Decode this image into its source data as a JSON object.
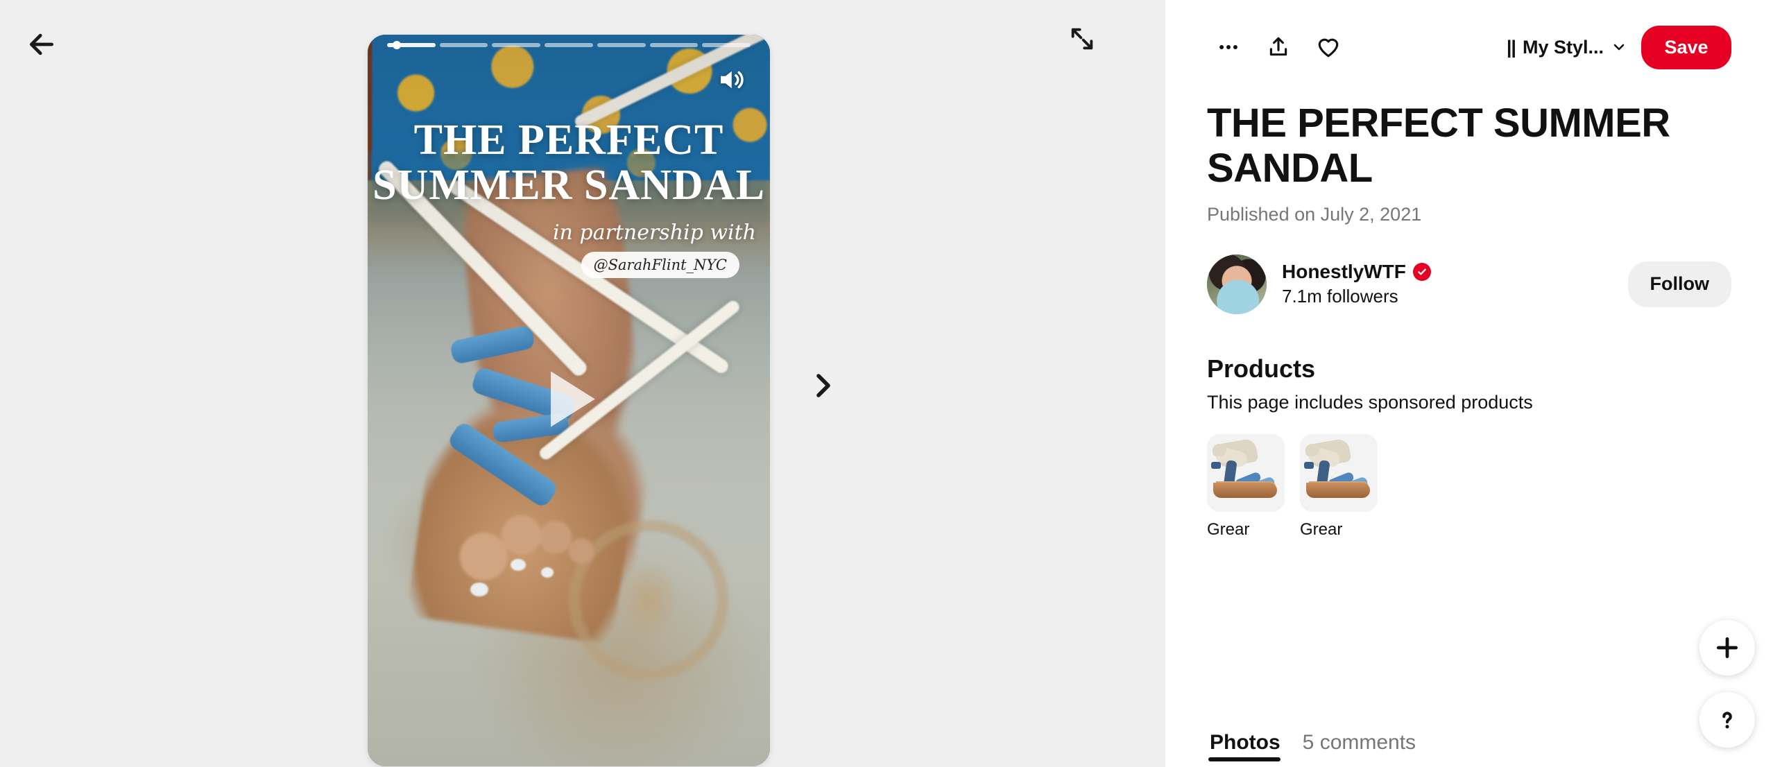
{
  "left": {
    "back_icon": "arrow-left-icon",
    "expand_icon": "expand-arrows-icon",
    "next_icon": "chevron-right-icon",
    "play_icon": "play-icon",
    "sound_icon": "volume-on-icon",
    "progress_segments": 7,
    "progress_active_index": 0,
    "overlay": {
      "line1": "THE PERFECT",
      "line2": "SUMMER SANDAL",
      "partnership": "in partnership with",
      "handle": "@SarahFlint_NYC"
    }
  },
  "topbar": {
    "more_icon": "ellipsis-icon",
    "share_icon": "share-upload-icon",
    "heart_icon": "heart-icon",
    "board_bars": "||",
    "board_name": "My Styl...",
    "board_chevron": "chevron-down-icon",
    "save_label": "Save"
  },
  "article": {
    "title": "THE PERFECT SUMMER SANDAL",
    "published": "Published on July 2, 2021"
  },
  "author": {
    "name": "HonestlyWTF",
    "verified_icon": "verified-check-icon",
    "followers": "7.1m followers",
    "follow_label": "Follow"
  },
  "products_section": {
    "heading": "Products",
    "subtitle": "This page includes sponsored products",
    "items": [
      {
        "label": "Grear"
      },
      {
        "label": "Grear"
      }
    ]
  },
  "tabs": [
    {
      "label": "Photos",
      "active": true
    },
    {
      "label": "5 comments",
      "active": false
    }
  ],
  "fabs": {
    "plus_icon": "plus-icon",
    "help_icon": "question-mark-icon"
  },
  "colors": {
    "brand_red": "#e60023",
    "page_bg": "#efefef",
    "panel_bg": "#ffffff",
    "muted_text": "#767676"
  }
}
